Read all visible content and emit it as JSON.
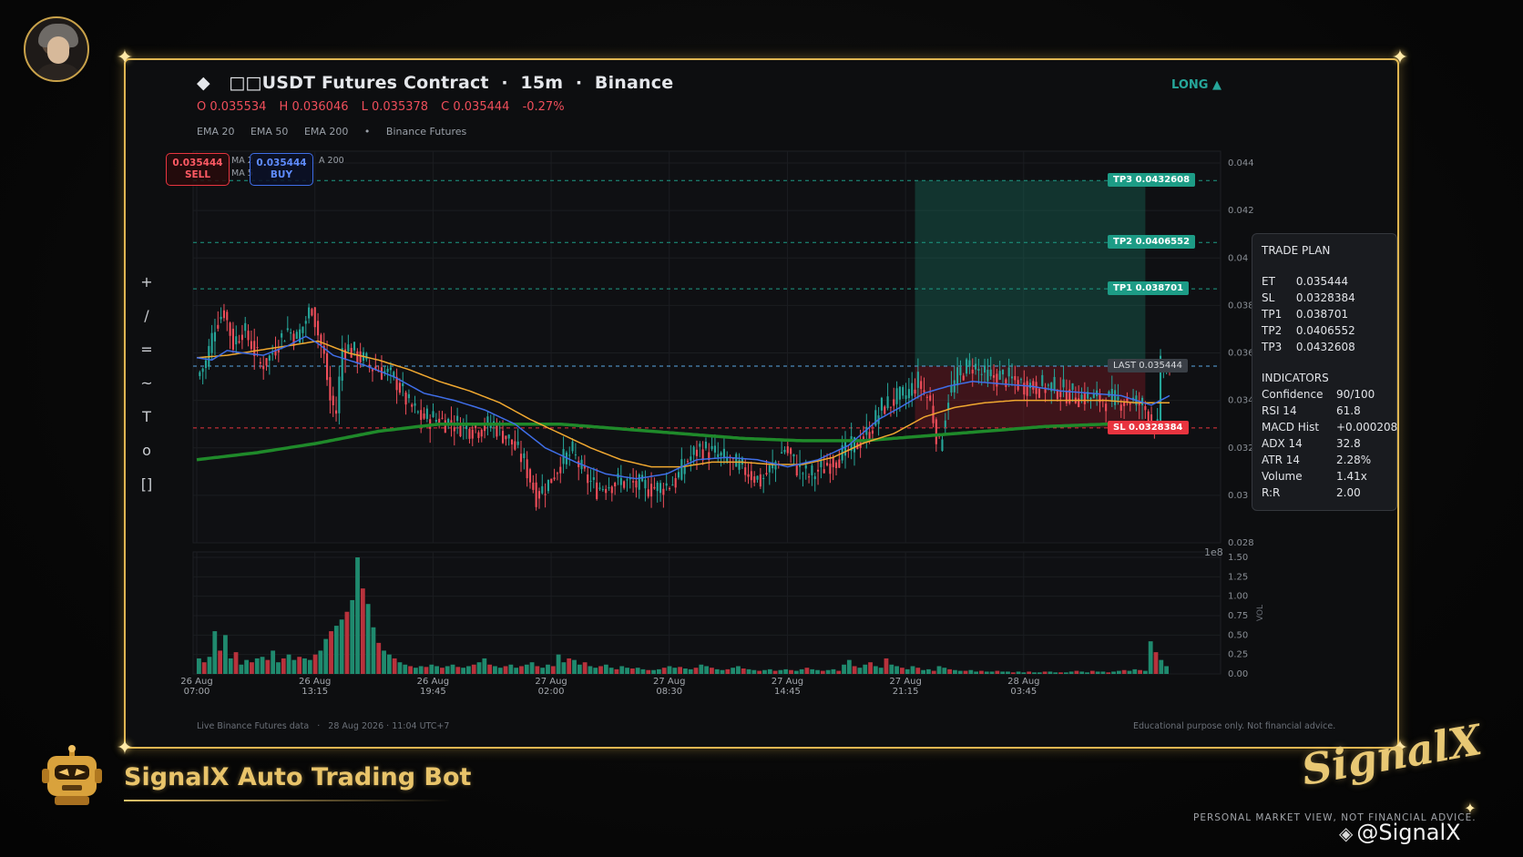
{
  "header": {
    "title_glyph": "◆",
    "title": "□□USDT Futures Contract  ·  15m  ·  Binance",
    "ohlc": [
      "O 0.035534",
      "H 0.036046",
      "L 0.035378",
      "C 0.035444",
      "-0.27%"
    ],
    "indicators": [
      "EMA 20",
      "EMA 50",
      "EMA 200",
      "•",
      "Binance Futures"
    ],
    "direction": "LONG ▲"
  },
  "toolbar": [
    "+",
    "/",
    "=",
    "~",
    "T",
    "o",
    "[]"
  ],
  "orders": {
    "sell_price": "0.035444",
    "sell_label": "SELL",
    "buy_price": "0.035444",
    "buy_label": "BUY"
  },
  "mini_legend": [
    "MA 2",
    "MA 5",
    "A 200"
  ],
  "levels": {
    "tp3": "TP3  0.0432608",
    "tp2": "TP2  0.0406552",
    "tp1": "TP1  0.038701",
    "last": "LAST  0.035444",
    "sl": "SL  0.0328384"
  },
  "plan": {
    "title": "TRADE PLAN",
    "rows": [
      [
        "ET",
        "0.035444"
      ],
      [
        "SL",
        "0.0328384"
      ],
      [
        "TP1",
        "0.038701"
      ],
      [
        "TP2",
        "0.0406552"
      ],
      [
        "TP3",
        "0.0432608"
      ]
    ],
    "ind_title": "INDICATORS",
    "ind_rows": [
      [
        "Confidence",
        "90/100"
      ],
      [
        "RSI 14",
        "61.8"
      ],
      [
        "MACD Hist",
        "+0.000208"
      ],
      [
        "ADX 14",
        "32.8"
      ],
      [
        "ATR 14",
        "2.28%"
      ],
      [
        "Volume",
        "1.41x"
      ],
      [
        "R:R",
        "2.00"
      ]
    ]
  },
  "footer": {
    "left": "Live Binance Futures data   ·   28 Aug 2026 · 11:04 UTC+7",
    "right": "Educational purpose only. Not financial advice."
  },
  "brand": {
    "name": "SignalX Auto Trading Bot",
    "logo": "SignalX",
    "disclaimer": "PERSONAL MARKET VIEW, NOT FINANCIAL ADVICE.",
    "handle": "@SignalX"
  },
  "colors": {
    "up": "#26a69a",
    "down": "#ef4e5a",
    "ema20": "#3f6ee8",
    "ema50": "#f0a830",
    "ema200": "#1f8a2a",
    "frame": "#e0b652"
  },
  "chart_data": {
    "type": "candlestick",
    "y_ticks": [
      "0.044",
      "0.042",
      "0.04",
      "0.038",
      "0.036",
      "0.034",
      "0.032",
      "0.03",
      "0.028"
    ],
    "y_scale_note": "1e8",
    "volume_ticks": [
      "1.50",
      "1.25",
      "1.00",
      "0.75",
      "0.50",
      "0.25",
      "0.00"
    ],
    "volume_label": "VOL",
    "x_ticks": [
      [
        "26 Aug",
        "07:00"
      ],
      [
        "26 Aug",
        "13:15"
      ],
      [
        "26 Aug",
        "19:45"
      ],
      [
        "27 Aug",
        "02:00"
      ],
      [
        "27 Aug",
        "08:30"
      ],
      [
        "27 Aug",
        "14:45"
      ],
      [
        "27 Aug",
        "21:15"
      ],
      [
        "28 Aug",
        "03:45"
      ]
    ],
    "ylim": [
      0.028,
      0.0445
    ],
    "vol_max": 1.5,
    "levels": {
      "tp3": 0.0432608,
      "tp2": 0.0406552,
      "tp1": 0.038701,
      "entry": 0.035444,
      "sl": 0.0328384
    },
    "ema20_path": [
      [
        0,
        0.0358
      ],
      [
        5,
        0.0357
      ],
      [
        10,
        0.0361
      ],
      [
        15,
        0.036
      ],
      [
        22,
        0.0359
      ],
      [
        30,
        0.0363
      ],
      [
        36,
        0.0367
      ],
      [
        40,
        0.0364
      ],
      [
        45,
        0.0359
      ],
      [
        55,
        0.0355
      ],
      [
        65,
        0.035
      ],
      [
        75,
        0.0343
      ],
      [
        85,
        0.034
      ],
      [
        95,
        0.0336
      ],
      [
        105,
        0.033
      ],
      [
        115,
        0.032
      ],
      [
        125,
        0.0314
      ],
      [
        135,
        0.0309
      ],
      [
        145,
        0.0307
      ],
      [
        155,
        0.0309
      ],
      [
        165,
        0.0315
      ],
      [
        175,
        0.0316
      ],
      [
        185,
        0.0315
      ],
      [
        195,
        0.0312
      ],
      [
        205,
        0.0315
      ],
      [
        215,
        0.0321
      ],
      [
        225,
        0.0332
      ],
      [
        232,
        0.0337
      ],
      [
        240,
        0.0343
      ],
      [
        248,
        0.0346
      ],
      [
        256,
        0.0348
      ],
      [
        265,
        0.0347
      ],
      [
        275,
        0.0346
      ],
      [
        285,
        0.0344
      ],
      [
        295,
        0.0343
      ],
      [
        305,
        0.0342
      ],
      [
        315,
        0.0338
      ],
      [
        321,
        0.0342
      ]
    ],
    "ema50_path": [
      [
        0,
        0.0358
      ],
      [
        10,
        0.0359
      ],
      [
        20,
        0.0361
      ],
      [
        30,
        0.0363
      ],
      [
        40,
        0.0365
      ],
      [
        50,
        0.036
      ],
      [
        60,
        0.0357
      ],
      [
        70,
        0.0353
      ],
      [
        80,
        0.0348
      ],
      [
        90,
        0.0344
      ],
      [
        100,
        0.0339
      ],
      [
        110,
        0.0332
      ],
      [
        120,
        0.0326
      ],
      [
        130,
        0.032
      ],
      [
        140,
        0.0315
      ],
      [
        150,
        0.0312
      ],
      [
        160,
        0.0312
      ],
      [
        170,
        0.0314
      ],
      [
        180,
        0.0314
      ],
      [
        190,
        0.0313
      ],
      [
        200,
        0.0313
      ],
      [
        210,
        0.0316
      ],
      [
        220,
        0.0322
      ],
      [
        230,
        0.0326
      ],
      [
        240,
        0.0333
      ],
      [
        250,
        0.0337
      ],
      [
        260,
        0.0339
      ],
      [
        270,
        0.034
      ],
      [
        280,
        0.034
      ],
      [
        290,
        0.034
      ],
      [
        300,
        0.034
      ],
      [
        310,
        0.0339
      ],
      [
        321,
        0.0339
      ]
    ],
    "ema200_path": [
      [
        0,
        0.0315
      ],
      [
        20,
        0.0318
      ],
      [
        40,
        0.0322
      ],
      [
        60,
        0.0327
      ],
      [
        80,
        0.033
      ],
      [
        100,
        0.033
      ],
      [
        120,
        0.033
      ],
      [
        140,
        0.0328
      ],
      [
        160,
        0.0326
      ],
      [
        180,
        0.0324
      ],
      [
        200,
        0.0323
      ],
      [
        220,
        0.0323
      ],
      [
        240,
        0.0325
      ],
      [
        260,
        0.0327
      ],
      [
        280,
        0.0329
      ],
      [
        300,
        0.033
      ],
      [
        321,
        0.033
      ]
    ],
    "price_path": [
      [
        0,
        0.035
      ],
      [
        3,
        0.0356
      ],
      [
        6,
        0.0372
      ],
      [
        9,
        0.0378
      ],
      [
        12,
        0.0364
      ],
      [
        15,
        0.037
      ],
      [
        18,
        0.0364
      ],
      [
        21,
        0.0355
      ],
      [
        24,
        0.0358
      ],
      [
        27,
        0.0365
      ],
      [
        30,
        0.037
      ],
      [
        33,
        0.0366
      ],
      [
        36,
        0.0374
      ],
      [
        38,
        0.038
      ],
      [
        40,
        0.0368
      ],
      [
        42,
        0.0358
      ],
      [
        44,
        0.034
      ],
      [
        46,
        0.0335
      ],
      [
        48,
        0.0362
      ],
      [
        50,
        0.0362
      ],
      [
        54,
        0.0358
      ],
      [
        58,
        0.0354
      ],
      [
        62,
        0.0352
      ],
      [
        66,
        0.0348
      ],
      [
        70,
        0.0338
      ],
      [
        74,
        0.0333
      ],
      [
        80,
        0.0332
      ],
      [
        86,
        0.033
      ],
      [
        92,
        0.0328
      ],
      [
        98,
        0.033
      ],
      [
        104,
        0.0322
      ],
      [
        108,
        0.0314
      ],
      [
        112,
        0.03
      ],
      [
        116,
        0.0305
      ],
      [
        120,
        0.0314
      ],
      [
        124,
        0.0318
      ],
      [
        128,
        0.0308
      ],
      [
        132,
        0.0303
      ],
      [
        136,
        0.0305
      ],
      [
        140,
        0.0306
      ],
      [
        146,
        0.0304
      ],
      [
        152,
        0.0303
      ],
      [
        158,
        0.0306
      ],
      [
        162,
        0.0315
      ],
      [
        166,
        0.032
      ],
      [
        170,
        0.0318
      ],
      [
        176,
        0.0314
      ],
      [
        182,
        0.031
      ],
      [
        186,
        0.0306
      ],
      [
        190,
        0.0312
      ],
      [
        194,
        0.032
      ],
      [
        198,
        0.0312
      ],
      [
        202,
        0.0308
      ],
      [
        206,
        0.0311
      ],
      [
        210,
        0.0315
      ],
      [
        214,
        0.0318
      ],
      [
        218,
        0.0322
      ],
      [
        222,
        0.0327
      ],
      [
        226,
        0.0337
      ],
      [
        230,
        0.034
      ],
      [
        234,
        0.0342
      ],
      [
        238,
        0.0348
      ],
      [
        242,
        0.0339
      ],
      [
        245,
        0.032
      ],
      [
        248,
        0.0342
      ],
      [
        252,
        0.0352
      ],
      [
        256,
        0.0355
      ],
      [
        260,
        0.035
      ],
      [
        266,
        0.035
      ],
      [
        272,
        0.0347
      ],
      [
        278,
        0.0346
      ],
      [
        284,
        0.0345
      ],
      [
        290,
        0.0342
      ],
      [
        296,
        0.0341
      ],
      [
        302,
        0.034
      ],
      [
        308,
        0.034
      ],
      [
        312,
        0.0338
      ],
      [
        315,
        0.0332
      ],
      [
        317,
        0.0328
      ],
      [
        318,
        0.0354
      ],
      [
        320,
        0.0354
      ],
      [
        321,
        0.0354
      ]
    ],
    "volume": [
      0.2,
      0.15,
      0.22,
      0.55,
      0.3,
      0.5,
      0.2,
      0.28,
      0.12,
      0.18,
      0.15,
      0.2,
      0.22,
      0.18,
      0.3,
      0.15,
      0.2,
      0.25,
      0.18,
      0.22,
      0.2,
      0.18,
      0.25,
      0.3,
      0.45,
      0.55,
      0.62,
      0.7,
      0.8,
      0.95,
      1.5,
      1.1,
      0.9,
      0.6,
      0.4,
      0.3,
      0.25,
      0.2,
      0.15,
      0.12,
      0.1,
      0.08,
      0.1,
      0.09,
      0.12,
      0.1,
      0.08,
      0.1,
      0.12,
      0.09,
      0.08,
      0.1,
      0.12,
      0.15,
      0.2,
      0.12,
      0.1,
      0.08,
      0.1,
      0.12,
      0.08,
      0.1,
      0.12,
      0.15,
      0.1,
      0.08,
      0.12,
      0.1,
      0.25,
      0.15,
      0.2,
      0.18,
      0.12,
      0.15,
      0.1,
      0.08,
      0.1,
      0.12,
      0.08,
      0.06,
      0.1,
      0.08,
      0.07,
      0.08,
      0.06,
      0.05,
      0.05,
      0.06,
      0.08,
      0.1,
      0.08,
      0.09,
      0.07,
      0.06,
      0.08,
      0.12,
      0.1,
      0.08,
      0.06,
      0.05,
      0.06,
      0.08,
      0.1,
      0.07,
      0.06,
      0.05,
      0.04,
      0.05,
      0.06,
      0.04,
      0.05,
      0.06,
      0.05,
      0.04,
      0.06,
      0.08,
      0.06,
      0.05,
      0.04,
      0.05,
      0.06,
      0.04,
      0.12,
      0.18,
      0.1,
      0.08,
      0.12,
      0.15,
      0.1,
      0.08,
      0.2,
      0.12,
      0.1,
      0.08,
      0.06,
      0.1,
      0.08,
      0.05,
      0.06,
      0.04,
      0.1,
      0.08,
      0.06,
      0.05,
      0.04,
      0.04,
      0.05,
      0.03,
      0.04,
      0.03,
      0.03,
      0.04,
      0.03,
      0.03,
      0.02,
      0.03,
      0.02,
      0.03,
      0.02,
      0.02,
      0.03,
      0.03,
      0.02,
      0.02,
      0.02,
      0.03,
      0.04,
      0.03,
      0.02,
      0.04,
      0.03,
      0.03,
      0.02,
      0.03,
      0.04,
      0.05,
      0.04,
      0.06,
      0.05,
      0.04,
      0.42,
      0.28,
      0.18,
      0.1
    ]
  }
}
